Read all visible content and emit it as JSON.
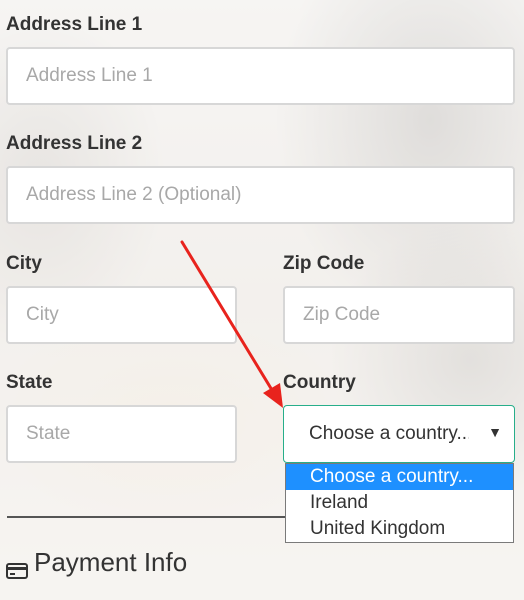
{
  "form": {
    "address1": {
      "label": "Address Line 1",
      "placeholder": "Address Line 1"
    },
    "address2": {
      "label": "Address Line 2",
      "placeholder": "Address Line 2 (Optional)"
    },
    "city": {
      "label": "City",
      "placeholder": "City"
    },
    "zip": {
      "label": "Zip Code",
      "placeholder": "Zip Code"
    },
    "state": {
      "label": "State",
      "placeholder": "State"
    },
    "country": {
      "label": "Country",
      "selected_display": "Choose a country...",
      "options": [
        "Choose a country...",
        "Ireland",
        "United Kingdom"
      ]
    }
  },
  "payment": {
    "title": "Payment Info",
    "icon": "credit-card-icon"
  },
  "colors": {
    "focus_border": "#27ae8a",
    "option_highlight": "#1e90ff",
    "annotation_arrow": "#e8231d"
  }
}
